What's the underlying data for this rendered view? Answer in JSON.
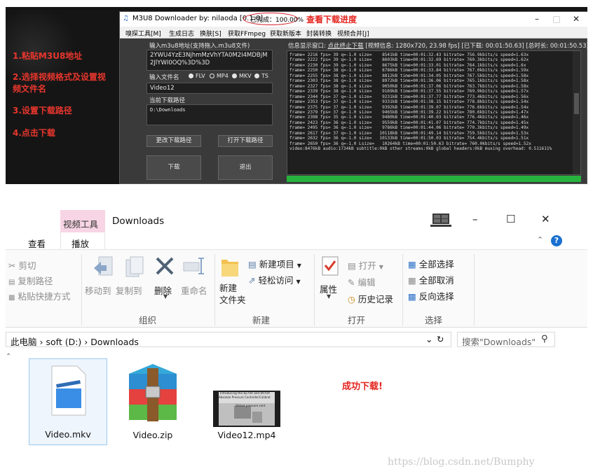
{
  "tutorial": {
    "steps": [
      "1.粘贴M3U8地址",
      "2.选择视频格式及设置视频文件名",
      "3.设置下载路径",
      "4.点击下载"
    ]
  },
  "app": {
    "title": "M3U8 Downloader  by: nilaoda [0.1.0]",
    "progress": "已完成：100.00%",
    "progress_note": "查看下载进度",
    "progress_fraction": 1.0,
    "menu": [
      "嗅探工具[M]",
      "生成日志",
      "换肤[S]",
      "获取FFmpeg",
      "获取新版本",
      "封装转换",
      "视频合并[J]"
    ],
    "url_label": "输入m3u8地址(支持拖入.m3u8文件)",
    "url_value": "2YWU4YzE3NjhmMzVhYTA0M2I4MDBjM2JlYWI0OQ%3D%3D",
    "filename_label": "输入文件名",
    "formats": [
      "FLV",
      "MP4",
      "MKV",
      "TS"
    ],
    "selected_format": "MP4",
    "filename_value": "Video12",
    "path_label": "当前下载路径",
    "path_value": "D:\\Downloads",
    "btn_change_path": "更改下载路径",
    "btn_open_path": "打开下载路径",
    "btn_download": "下载",
    "btn_exit": "退出",
    "info_prefix": "信息显示窗口:",
    "info_stop": "点此终止下载",
    "info_rest": "[视频信息: 1280x720, 23.98 fps]  [已下载: 00:01:50.63]  [总时长: 00:01:50.53]",
    "log": "frame= 2216 fps= 39 q=-1.0 size=    8541kB time=00:01:32.43 bitrate= 756.9kbits/s speed=1.63x\nframe= 2222 fps= 39 q=-1.0 size=    8603kB time=00:01:32.69 bitrate= 760.3kbits/s speed=1.62x\nframe= 2230 fps= 39 q=-1.0 size=    8675kB time=00:01:33.01 bitrate= 764.1kbits/s speed=1.6x\nframe= 2250 fps= 38 q=-1.0 size=    8786kB time=00:01:33.84 bitrate= 767.0kbits/s speed=1.59x\nframe= 2255 fps= 38 q=-1.0 size=    8812kB time=00:01:34.05 bitrate= 767.5kbits/s speed=1.58x\nframe= 2303 fps= 38 q=-1.0 size=    8972kB time=00:01:36.06 bitrate= 765.1kbits/s speed=1.58x\nframe= 2327 fps= 38 q=-1.0 size=    9050kB time=00:01:37.06 bitrate= 763.7kbits/s speed=1.58x\nframe= 2339 fps= 38 q=-1.0 size=    9169kB time=00:01:37.55 bitrate= 769.9kbits/s speed=1.57x\nframe= 2344 fps= 37 q=-1.0 size=    9231kB time=00:01:37.77 bitrate= 773.4kbits/s speed=1.56x\nframe= 2353 fps= 37 q=-1.0 size=    9331kB time=00:01:38.15 bitrate= 778.8kbits/s speed=1.54x\nframe= 2375 fps= 37 q=-1.0 size=    9392kB time=00:01:39.07 bitrate= 776.6kbits/s speed=1.54x\nframe= 2379 fps= 37 q=-1.0 size=    9465kB time=00:01:39.22 bitrate= 780.6kbits/s speed=1.47x\nframe= 2398 fps= 35 q=-1.0 size=    9480kB time=00:01:40.03 bitrate= 776.4kbits/s speed=1.46x\nframe= 2423 fps= 36 q=-1.0 size=    9559kB time=00:01:41.07 bitrate= 774.7kbits/s speed=1.45x\nframe= 2495 fps= 36 q=-1.0 size=    9786kB time=00:01:44.06 bitrate= 770.3kbits/s speed=1.49x\nframe= 2617 fps= 37 q=-1.0 size=   10118kB time=00:01:49.14 bitrate= 759.5kbits/s speed=1.53x\nframe= 2632 fps= 36 q=-1.0 size=   10133kB time=00:01:50.03 bitrate= 754.4kbits/s speed=1.51x\nframe= 2650 fps= 36 q=-1.0 Lsize=   10264kB time=00:01:50.63 bitrate= 760.0kbits/s speed=1.52x\nvideo:8476kB audio:1734kB subtitle:0kB other streams:0kB global headers:0kB muxing overhead: 0.511611%"
  },
  "explorer": {
    "tools_tab": "视频工具",
    "title": "Downloads",
    "tabs": [
      "查看",
      "播放"
    ],
    "clipboard": [
      "剪切",
      "复制路径",
      "粘贴快捷方式"
    ],
    "organize": [
      "移动到",
      "复制到",
      "删除",
      "重命名"
    ],
    "new_item": "新建项目",
    "easy_access": "轻松访问",
    "new_folder": "新建\n文件夹",
    "properties": "属性",
    "open": "打开",
    "edit": "编辑",
    "history": "历史记录",
    "select_all": "全部选择",
    "select_none": "全部取消",
    "invert": "反向选择",
    "groups": [
      "组织",
      "新建",
      "打开",
      "选择"
    ],
    "breadcrumb": [
      "此电脑",
      "soft (D:)",
      "Downloads"
    ],
    "search_placeholder": "搜索\"Downloads\"",
    "files": [
      "Video.mkv",
      "Video.zip",
      "Video12.mp4"
    ],
    "thumb_line1": "Introducing the 8270A and 8970A",
    "thumb_line2": "Absolute Pressure Controller/Calibrat",
    "thumb_line3": "Widest pressure cont"
  },
  "success_text": "成功下载!",
  "watermark": "https://blog.csdn.net/Bumphy",
  "colors": {
    "accent_red": "#e4241e",
    "progress_green": "#27b23d",
    "tools_tab_pink": "#f8d5e4",
    "selected_file_blue": "#eef5fd"
  }
}
